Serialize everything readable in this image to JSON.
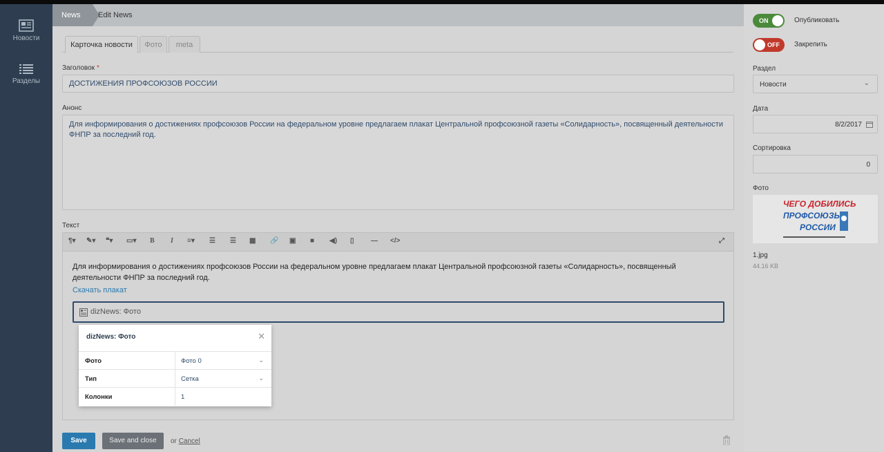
{
  "sidebar": {
    "items": [
      {
        "label": "Новости",
        "icon": "newspaper-icon"
      },
      {
        "label": "Разделы",
        "icon": "list-icon"
      }
    ]
  },
  "breadcrumb": {
    "news": "News",
    "current": "Edit News"
  },
  "tabs": [
    {
      "label": "Карточка новости",
      "active": true
    },
    {
      "label": "Фото",
      "active": false
    },
    {
      "label": "meta",
      "active": false
    }
  ],
  "form": {
    "title_label": "Заголовок",
    "title_required_mark": "*",
    "title_value": "ДОСТИЖЕНИЯ ПРОФСОЮЗОВ РОССИИ",
    "announce_label": "Анонс",
    "announce_value": "Для информирования о достижениях профсоюзов России на федеральном уровне предлагаем плакат Центральной профсоюзной газеты «Солидарность», посвященный деятельности ФНПР за последний год.",
    "text_label": "Текст"
  },
  "editor": {
    "paragraph": "Для информирования о достижениях профсоюзов России на федеральном уровне предлагаем плакат Центральной профсоюзной газеты «Солидарность», посвященный деятельности ФНПР за последний год.",
    "link_text": "Скачать плакат",
    "widget_label": "dizNews: Фото",
    "toolbar_icons": [
      "paragraph-icon",
      "magic-icon",
      "quote-icon",
      "code-block-icon",
      "bold-icon",
      "italic-icon",
      "align-icon",
      "ordered-list-icon",
      "unordered-list-icon",
      "table-icon",
      "link-icon",
      "image-icon",
      "video-icon",
      "audio-icon",
      "file-icon",
      "hr-icon",
      "source-icon",
      "fullscreen-icon"
    ]
  },
  "popup": {
    "title": "dizNews: Фото",
    "rows": [
      {
        "key": "Фото",
        "value": "Фото 0",
        "select": true
      },
      {
        "key": "Тип",
        "value": "Сетка",
        "select": true
      },
      {
        "key": "Колонки",
        "value": "1",
        "select": false
      }
    ]
  },
  "actions": {
    "save": "Save",
    "save_close": "Save and close",
    "or": "or",
    "cancel": "Cancel"
  },
  "right": {
    "publish": {
      "state": "ON",
      "label": "Опубликовать"
    },
    "pin": {
      "state": "OFF",
      "label": "Закрепить"
    },
    "section_label": "Раздел",
    "section_value": "Новости",
    "date_label": "Дата",
    "date_value": "8/2/2017",
    "sort_label": "Сортировка",
    "sort_value": "0",
    "photo_label": "Фото",
    "photo_text": [
      "ЧЕГО ДОБИЛИСЬ",
      "ПРОФСОЮЗЫ",
      "РОССИИ"
    ],
    "file_name": "1.jpg",
    "file_size": "44.16 KB"
  },
  "colors": {
    "accent": "#2a7ab0",
    "sidebar": "#2e3e50",
    "on": "#4a8a3a",
    "off": "#c0392b"
  }
}
